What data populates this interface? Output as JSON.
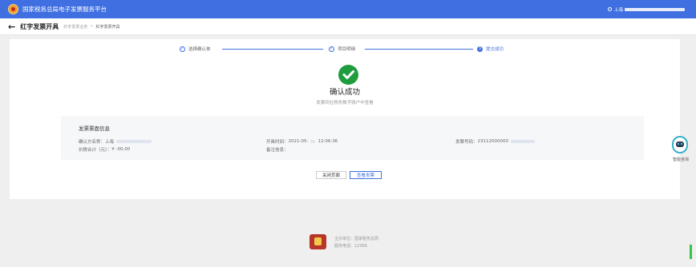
{
  "header": {
    "app_title": "国家税务总局电子发票服务平台",
    "user_prefix": "上海"
  },
  "breadcrumb": {
    "back_icon": "back-arrow-icon",
    "page_title": "红字发票开具",
    "items": [
      "红字发票业务",
      "红字发票开具"
    ],
    "separator": ">"
  },
  "steps": [
    {
      "number": "",
      "label": "选择确认单",
      "state": "done"
    },
    {
      "number": "",
      "label": "项目明细",
      "state": "done"
    },
    {
      "number": "3",
      "label": "提交成功",
      "state": "active"
    }
  ],
  "result": {
    "icon": "checkmark-icon",
    "title": "确认成功",
    "subtitle": "发票同在税务数字账户中查看"
  },
  "invoice_info": {
    "heading": "发票票面信息",
    "buyer_label": "确认方名称：",
    "buyer_value": "上海",
    "issue_time_label": "开具时间：",
    "issue_time_value": "2021-05-",
    "issue_time_clock": "12:06:36",
    "invoice_no_label": "发票号码：",
    "invoice_no_value": "23112000000",
    "amount_label": "价税合计（元）：",
    "amount_value": "¥ -00.00",
    "remark_label": "备注信息："
  },
  "buttons": {
    "close_label": "关闭页面",
    "view_label": "查看发票"
  },
  "assistant": {
    "label": "智能咨询"
  },
  "footer": {
    "org_label": "主办单位：国家税务总局",
    "phone_label": "服务电话：12366"
  },
  "colors": {
    "brand_blue": "#3f6fe0",
    "success_green": "#1f9d3e"
  }
}
